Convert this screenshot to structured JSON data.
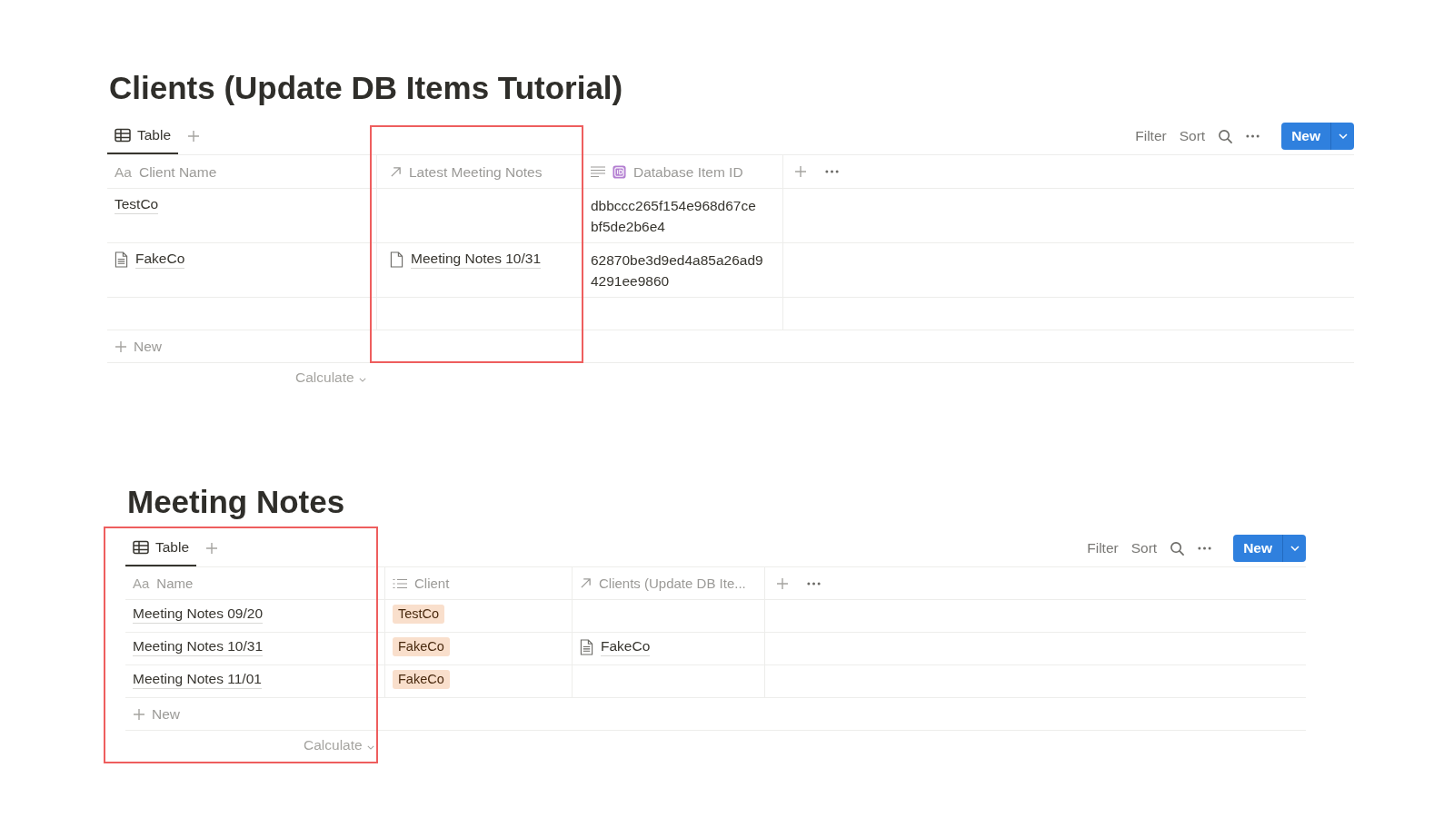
{
  "databases": [
    {
      "title": "Clients (Update DB Items Tutorial)",
      "view_highlighted": false,
      "view_tabs": [
        {
          "label": "Table",
          "selected": true
        }
      ],
      "toolbar": {
        "filter": "Filter",
        "sort": "Sort",
        "new_button": "New"
      },
      "columns": [
        {
          "kind": "title",
          "type_glyph": "Aa",
          "label": "Client Name",
          "highlighted": false
        },
        {
          "kind": "relation",
          "label": "Latest Meeting Notes",
          "highlighted": true
        },
        {
          "kind": "id",
          "label": "Database Item ID",
          "highlighted": false
        }
      ],
      "rows": [
        {
          "kind": "record",
          "cells": [
            {
              "kind": "title",
              "text": "TestCo"
            },
            {
              "kind": "empty"
            },
            {
              "kind": "text",
              "text": "dbbccc265f154e968d67cebf5de2b6e4"
            }
          ]
        },
        {
          "kind": "record",
          "cells": [
            {
              "kind": "title",
              "text": "FakeCo",
              "icon": {
                "kind": "text_page"
              }
            },
            {
              "kind": "relation",
              "text": "Meeting Notes 10/31",
              "icon": {
                "kind": "blank_page"
              }
            },
            {
              "kind": "text",
              "text": "62870be3d9ed4a85a26ad94291ee9860"
            }
          ]
        },
        {
          "kind": "blank"
        }
      ],
      "new_row": "New",
      "calculate": "Calculate"
    },
    {
      "title": "Meeting Notes",
      "view_highlighted": true,
      "view_tabs": [
        {
          "label": "Table",
          "selected": true
        }
      ],
      "toolbar": {
        "filter": "Filter",
        "sort": "Sort",
        "new_button": "New"
      },
      "columns": [
        {
          "kind": "title",
          "type_glyph": "Aa",
          "label": "Name",
          "highlighted": false
        },
        {
          "kind": "select",
          "label": "Client",
          "highlighted": false
        },
        {
          "kind": "relation",
          "label": "Clients (Update DB Ite...",
          "highlighted": false
        }
      ],
      "rows": [
        {
          "kind": "record",
          "cells": [
            {
              "kind": "title",
              "text": "Meeting Notes 09/20"
            },
            {
              "kind": "tag",
              "text": "TestCo",
              "color": "#f9dfcc"
            },
            {
              "kind": "empty"
            }
          ]
        },
        {
          "kind": "record",
          "cells": [
            {
              "kind": "title",
              "text": "Meeting Notes 10/31"
            },
            {
              "kind": "tag",
              "text": "FakeCo",
              "color": "#f9dfcc"
            },
            {
              "kind": "relation",
              "text": "FakeCo",
              "icon": {
                "kind": "text_page"
              }
            }
          ]
        },
        {
          "kind": "record",
          "cells": [
            {
              "kind": "title",
              "text": "Meeting Notes 11/01"
            },
            {
              "kind": "tag",
              "text": "FakeCo",
              "color": "#f9dfcc"
            },
            {
              "kind": "empty"
            }
          ]
        }
      ],
      "new_row": "New",
      "calculate": "Calculate"
    }
  ]
}
